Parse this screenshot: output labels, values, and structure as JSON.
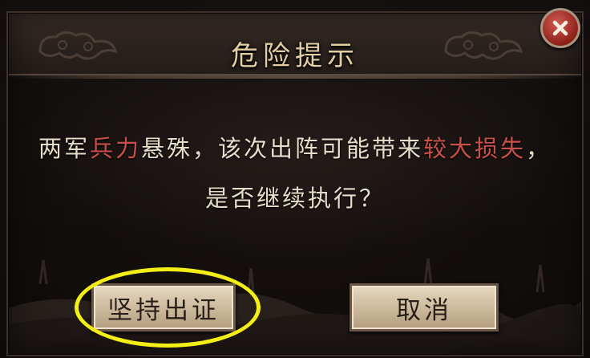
{
  "dialog": {
    "title": "危险提示",
    "message": {
      "line1": [
        {
          "text": "两军",
          "highlight": false
        },
        {
          "text": "兵力",
          "highlight": true
        },
        {
          "text": "悬殊，该次出阵可能带来",
          "highlight": false
        },
        {
          "text": "较大损失",
          "highlight": true
        },
        {
          "text": "，",
          "highlight": false
        }
      ],
      "line2": "是否继续执行？"
    },
    "buttons": {
      "confirm_label": "坚持出证",
      "cancel_label": "取消"
    },
    "close_icon": "close-icon"
  },
  "colors": {
    "title": "#e2cfa6",
    "highlight": "#c9504a",
    "annotation_ring": "#f3ee16"
  }
}
